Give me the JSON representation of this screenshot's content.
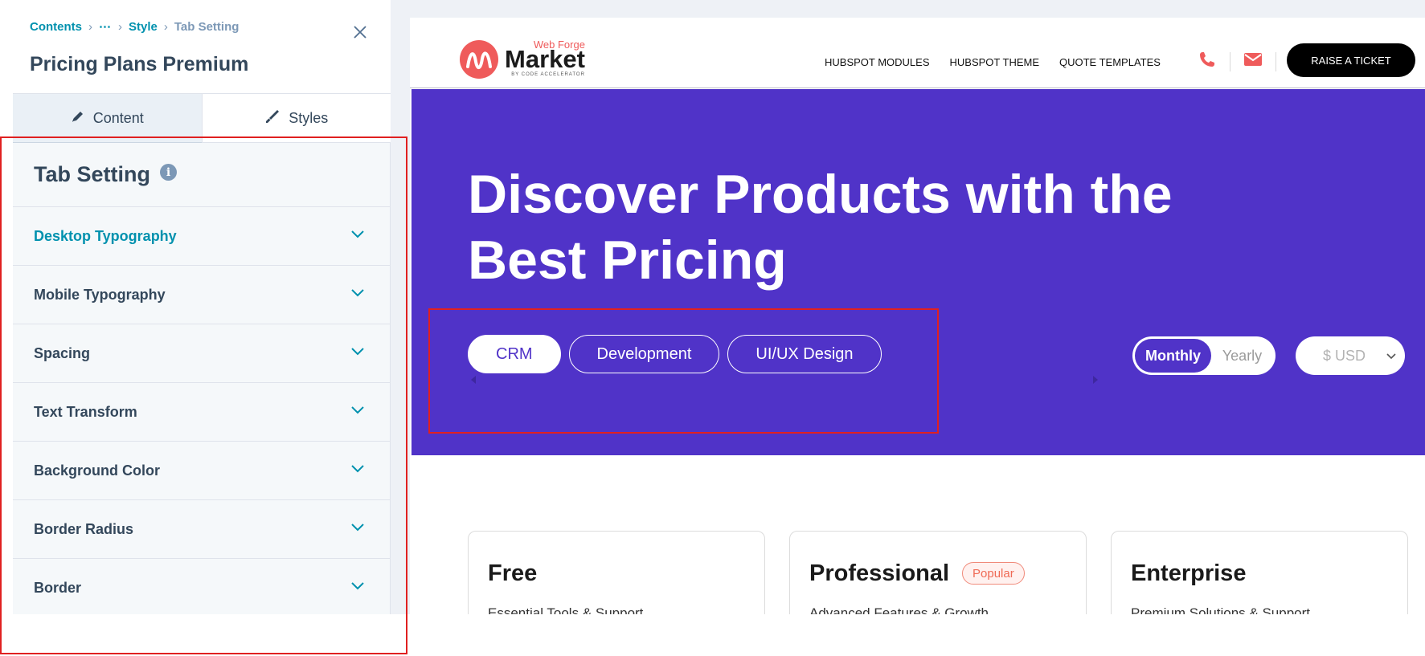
{
  "editor": {
    "breadcrumb": {
      "root": "Contents",
      "ellipsis": "⋯",
      "style": "Style",
      "current": "Tab Setting"
    },
    "title": "Pricing Plans Premium",
    "tabs": {
      "content": "Content",
      "styles": "Styles"
    },
    "section": {
      "title": "Tab Setting",
      "info_icon": "i",
      "items": [
        {
          "label": "Desktop Typography",
          "active": true
        },
        {
          "label": "Mobile Typography"
        },
        {
          "label": "Spacing"
        },
        {
          "label": "Text Transform"
        },
        {
          "label": "Background Color"
        },
        {
          "label": "Border Radius"
        },
        {
          "label": "Border"
        }
      ]
    }
  },
  "site": {
    "logo": {
      "top": "Web Forge",
      "main": "Market",
      "sub": "BY CODE ACCELERATOR"
    },
    "nav": [
      "HUBSPOT MODULES",
      "HUBSPOT THEME",
      "QUOTE TEMPLATES"
    ],
    "icons": [
      "phone-icon",
      "mail-icon"
    ],
    "ticket_button": "RAISE A TICKET",
    "hero": {
      "title_line1": "Discover Products with the",
      "title_line2": "Best Pricing",
      "categories": [
        "CRM",
        "Development",
        "UI/UX Design"
      ],
      "active_category": "CRM",
      "billing": {
        "monthly": "Monthly",
        "yearly": "Yearly",
        "selected": "Monthly"
      },
      "currency": "$ USD"
    },
    "plans": [
      {
        "name": "Free",
        "subtitle": "Essential Tools & Support"
      },
      {
        "name": "Professional",
        "badge": "Popular",
        "subtitle": "Advanced Features & Growth"
      },
      {
        "name": "Enterprise",
        "subtitle": "Premium Solutions & Support"
      }
    ]
  },
  "colors": {
    "hero_bg": "#5033c8",
    "accent_teal": "#0091ae",
    "text_dark": "#33475b",
    "brand_red": "#ef5b5b",
    "annotation_red": "#e02020"
  }
}
